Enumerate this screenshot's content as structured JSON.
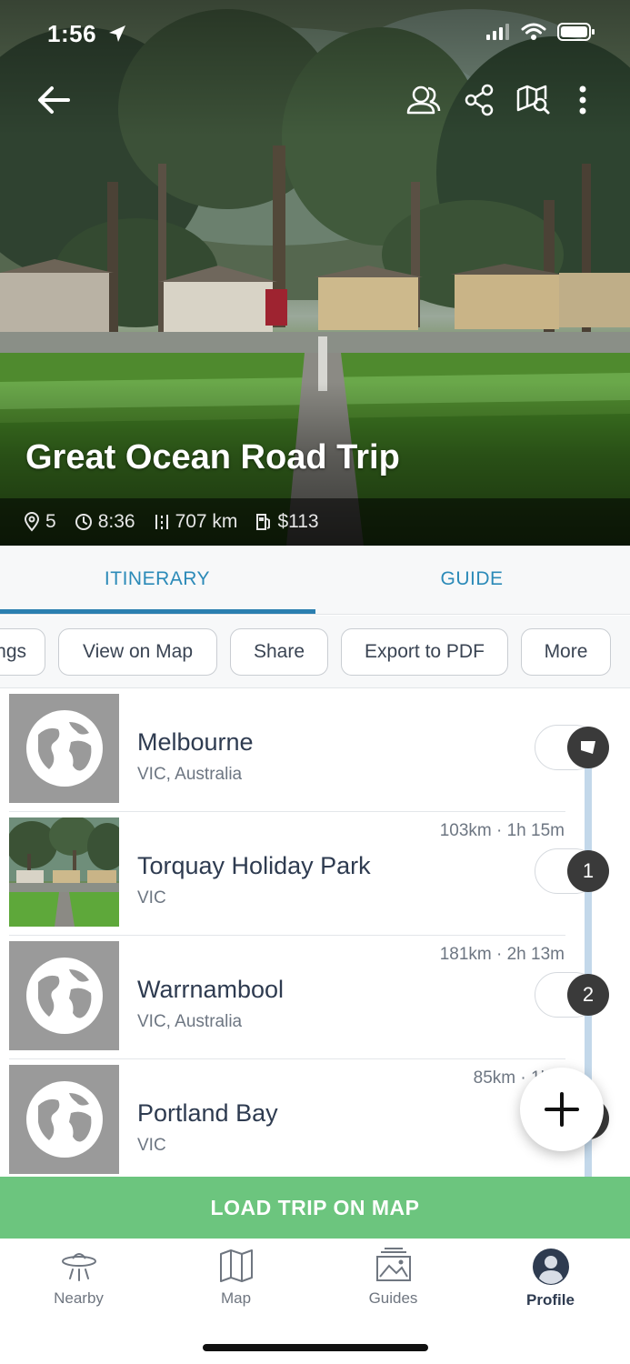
{
  "status_bar": {
    "time": "1:56"
  },
  "trip": {
    "title": "Great Ocean Road Trip",
    "stops_count": "5",
    "duration": "8:36",
    "distance": "707 km",
    "cost": "$113"
  },
  "tabs": [
    {
      "label": "ITINERARY",
      "active": true
    },
    {
      "label": "GUIDE",
      "active": false
    }
  ],
  "actions": [
    "ngs",
    "View on Map",
    "Share",
    "Export to PDF",
    "More"
  ],
  "stops": [
    {
      "name": "Melbourne",
      "region": "VIC, Australia",
      "leg": "",
      "marker": "",
      "thumb": "globe-icon"
    },
    {
      "name": "Torquay Holiday Park",
      "region": "VIC",
      "leg": "103km · 1h 15m",
      "marker": "1",
      "thumb": "photo"
    },
    {
      "name": "Warrnambool",
      "region": "VIC, Australia",
      "leg": "181km · 2h 13m",
      "marker": "2",
      "thumb": "globe-icon"
    },
    {
      "name": "Portland Bay",
      "region": "VIC",
      "leg": "85km · 1h 3",
      "marker": "",
      "thumb": "globe-icon"
    }
  ],
  "load_button": "LOAD TRIP ON MAP",
  "bottom_nav": [
    {
      "label": "Nearby",
      "icon": "ufo-icon",
      "active": false
    },
    {
      "label": "Map",
      "icon": "map-icon",
      "active": false
    },
    {
      "label": "Guides",
      "icon": "guides-icon",
      "active": false
    },
    {
      "label": "Profile",
      "icon": "profile-icon",
      "active": true
    }
  ],
  "colors": {
    "accent": "#2b7fb0",
    "load_button": "#6cc57e",
    "text_primary": "#2e3b50",
    "route_line": "#c3d8ea"
  }
}
